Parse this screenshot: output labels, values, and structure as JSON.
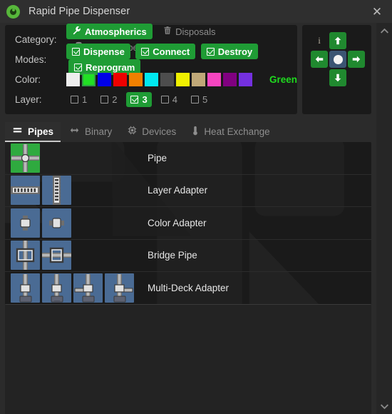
{
  "window": {
    "title": "Rapid Pipe Dispenser",
    "app_icon": "eye-icon",
    "close_label": "✕"
  },
  "config": {
    "category": {
      "label": "Category:",
      "options": [
        {
          "label": "Atmospherics",
          "icon": "wrench-icon",
          "selected": true
        },
        {
          "label": "Disposals",
          "icon": "trash-icon",
          "selected": false
        },
        {
          "label": "Transit Tubes",
          "icon": "tram-icon",
          "selected": false
        }
      ]
    },
    "modes": {
      "label": "Modes:",
      "options": [
        {
          "label": "Dispense",
          "checked": true
        },
        {
          "label": "Connect",
          "checked": true
        },
        {
          "label": "Destroy",
          "checked": true
        },
        {
          "label": "Reprogram",
          "checked": true
        }
      ]
    },
    "color": {
      "label": "Color:",
      "selected_name": "Green",
      "selected_index": 1,
      "swatches": [
        {
          "name": "White",
          "hex": "#eeeeee"
        },
        {
          "name": "Green",
          "hex": "#22e024"
        },
        {
          "name": "Blue",
          "hex": "#0000e8"
        },
        {
          "name": "Red",
          "hex": "#ee0000"
        },
        {
          "name": "Orange",
          "hex": "#f08000"
        },
        {
          "name": "Cyan",
          "hex": "#00e8f0"
        },
        {
          "name": "Gray",
          "hex": "#4d4d4d"
        },
        {
          "name": "Yellow",
          "hex": "#f0f000"
        },
        {
          "name": "Tan",
          "hex": "#c0a878"
        },
        {
          "name": "Pink",
          "hex": "#f545c0"
        },
        {
          "name": "Purple",
          "hex": "#800080"
        },
        {
          "name": "Violet",
          "hex": "#7430e0"
        }
      ]
    },
    "layer": {
      "label": "Layer:",
      "options": [
        {
          "label": "1",
          "checked": false
        },
        {
          "label": "2",
          "checked": false
        },
        {
          "label": "3",
          "checked": true
        },
        {
          "label": "4",
          "checked": false
        },
        {
          "label": "5",
          "checked": false
        }
      ]
    }
  },
  "dpad": {
    "info_label": "i",
    "up_label": "↑",
    "left_label": "←",
    "center_label": "●",
    "right_label": "→",
    "down_label": "↓"
  },
  "tabs": [
    {
      "label": "Pipes",
      "icon": "pipes-icon",
      "active": true
    },
    {
      "label": "Binary",
      "icon": "arrows-horizontal-icon",
      "active": false
    },
    {
      "label": "Devices",
      "icon": "chip-icon",
      "active": false
    },
    {
      "label": "Heat Exchange",
      "icon": "thermometer-icon",
      "active": false
    }
  ],
  "list": {
    "rows": [
      {
        "label": "Pipe",
        "thumbs": 1,
        "selected_thumb": 0,
        "kind": "cross"
      },
      {
        "label": "Layer Adapter",
        "thumbs": 2,
        "selected_thumb": -1,
        "kind": "layer"
      },
      {
        "label": "Color Adapter",
        "thumbs": 2,
        "selected_thumb": -1,
        "kind": "color"
      },
      {
        "label": "Bridge Pipe",
        "thumbs": 2,
        "selected_thumb": -1,
        "kind": "bridge"
      },
      {
        "label": "Multi-Deck Adapter",
        "thumbs": 4,
        "selected_thumb": -1,
        "kind": "deck"
      }
    ]
  },
  "scrollbar": {
    "up_label": "⌃",
    "down_label": "⌄"
  },
  "colors": {
    "accent_green": "#1f9c35",
    "panel_bg": "#1a1a1a",
    "window_bg": "#2b2b2b",
    "thumb_blue": "#4a6b94",
    "selected_green_text": "#1fdb1f"
  }
}
